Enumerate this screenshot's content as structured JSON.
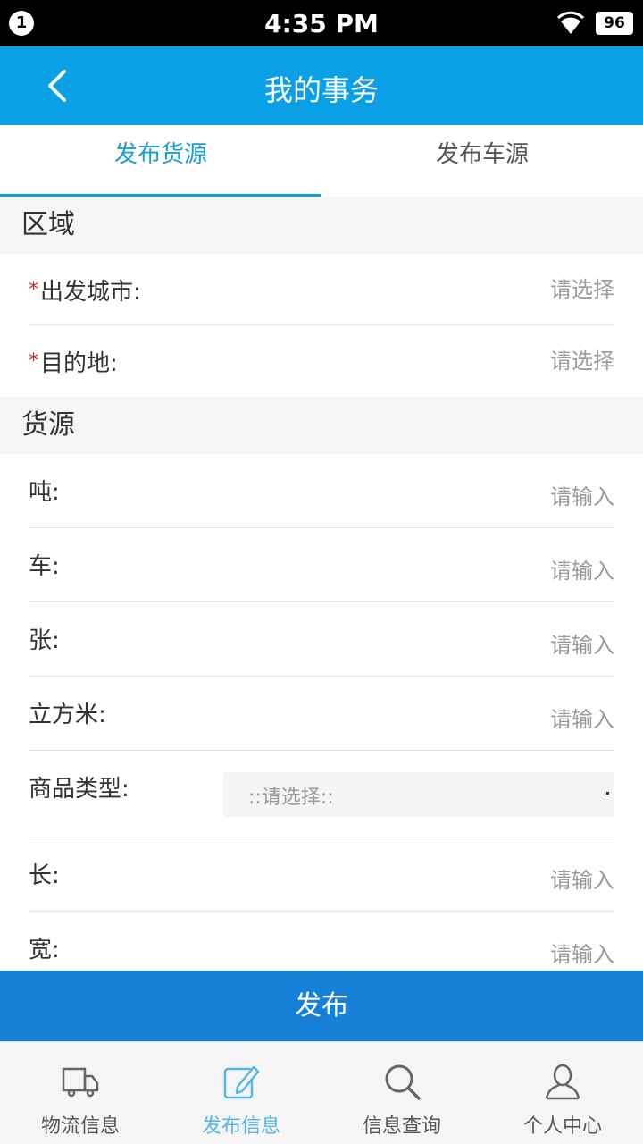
{
  "status_bar": {
    "notification_count": "1",
    "time": "4:35 PM",
    "battery": "96"
  },
  "header": {
    "title": "我的事务"
  },
  "tabs": [
    {
      "label": "发布货源",
      "active": true
    },
    {
      "label": "发布车源",
      "active": false
    }
  ],
  "region_section": {
    "title": "区域",
    "fields": [
      {
        "required_mark": "*",
        "label": "出发城市:",
        "placeholder": "请选择"
      },
      {
        "required_mark": "*",
        "label": "目的地:",
        "placeholder": "请选择"
      }
    ]
  },
  "cargo_section": {
    "title": "货源",
    "fields": [
      {
        "label": "吨:",
        "placeholder": "请输入"
      },
      {
        "label": "车:",
        "placeholder": "请输入"
      },
      {
        "label": "张:",
        "placeholder": "请输入"
      },
      {
        "label": "立方米:",
        "placeholder": "请输入"
      }
    ],
    "product_type": {
      "label": "商品类型:",
      "selected": "::请选择::"
    },
    "dimensions": [
      {
        "label": "长:",
        "placeholder": "请输入"
      },
      {
        "label": "宽:",
        "placeholder": "请输入"
      }
    ]
  },
  "publish_button": {
    "label": "发布"
  },
  "bottom_nav": [
    {
      "label": "物流信息",
      "icon": "truck-icon",
      "active": false
    },
    {
      "label": "发布信息",
      "icon": "edit-icon",
      "active": true
    },
    {
      "label": "信息查询",
      "icon": "search-icon",
      "active": false
    },
    {
      "label": "个人中心",
      "icon": "user-icon",
      "active": false
    }
  ],
  "colors": {
    "header": "#0aa0e6",
    "tab_active": "#1aa0d8",
    "publish": "#1680d6",
    "required": "#d2262b"
  }
}
